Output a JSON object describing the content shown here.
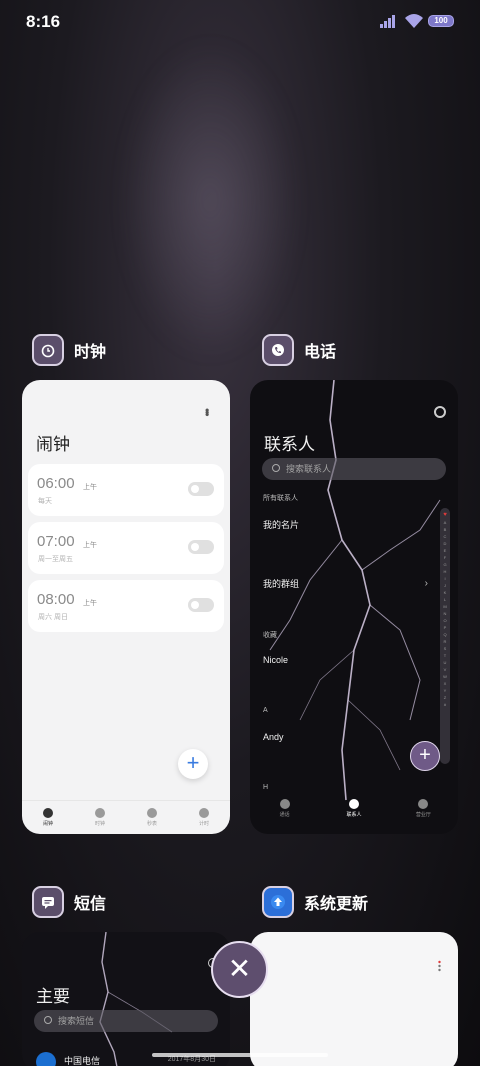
{
  "status_bar": {
    "time": "8:16",
    "battery": "100"
  },
  "clock_app": {
    "name": "时钟",
    "title": "闹钟",
    "alarms": [
      {
        "time": "06:00",
        "ampm": "上午",
        "repeat": "每天"
      },
      {
        "time": "07:00",
        "ampm": "上午",
        "repeat": "周一至周五"
      },
      {
        "time": "08:00",
        "ampm": "上午",
        "repeat": "周六 周日"
      }
    ],
    "nav": [
      "闹钟",
      "时钟",
      "秒表",
      "计时"
    ],
    "active_nav": "闹钟"
  },
  "contacts_app": {
    "name": "电话",
    "title": "联系人",
    "search_placeholder": "搜索联系人",
    "all_contacts": "所有联系人",
    "my_card": "我的名片",
    "my_groups": "我的群组",
    "favorites_label": "收藏",
    "favorite_name": "Nicole",
    "section_a": "A",
    "contact_a": "Andy",
    "section_h": "H",
    "alphabet": [
      "A",
      "B",
      "C",
      "D",
      "E",
      "F",
      "G",
      "H",
      "I",
      "J",
      "K",
      "L",
      "M",
      "N",
      "O",
      "P",
      "Q",
      "R",
      "S",
      "T",
      "U",
      "V",
      "W",
      "X",
      "Y",
      "Z",
      "#"
    ],
    "nav": [
      "通话",
      "联系人",
      "营业厅"
    ],
    "active_nav": "联系人"
  },
  "sms_app": {
    "name": "短信",
    "title": "主要",
    "search_placeholder": "搜索短信",
    "first_sender": "中国电信",
    "first_date": "2017年8月30日"
  },
  "update_app": {
    "name": "系统更新"
  },
  "colors": {
    "accent_purple": "#6f5a87",
    "fab_blue": "#3a7be0",
    "battery": "#7e78c9"
  }
}
